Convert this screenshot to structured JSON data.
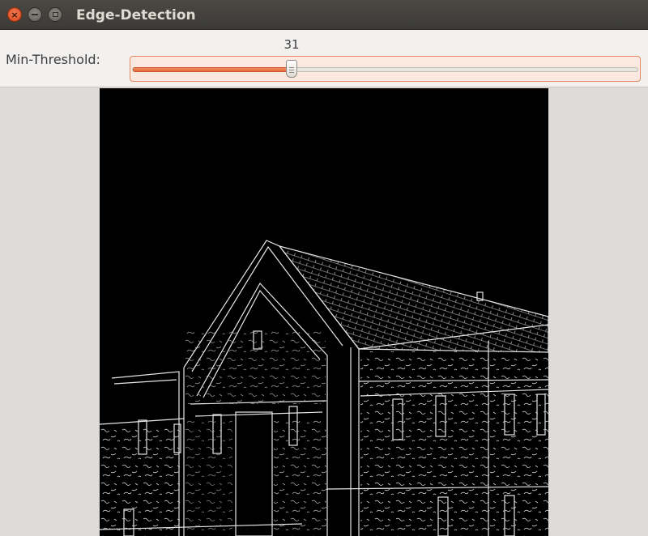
{
  "window": {
    "title": "Edge-Detection",
    "buttons": [
      "close-icon",
      "minimize-icon",
      "maximize-icon"
    ]
  },
  "controls": {
    "threshold_label": "Min-Threshold:",
    "threshold_value": "31",
    "threshold_fraction": 0.31
  },
  "image": {
    "description_icon": "edge-detected-building-image"
  },
  "colors": {
    "titlebar": "#3c3b37",
    "accent": "#e86a34",
    "canvas": "#000000",
    "edges": "#ffffff"
  }
}
